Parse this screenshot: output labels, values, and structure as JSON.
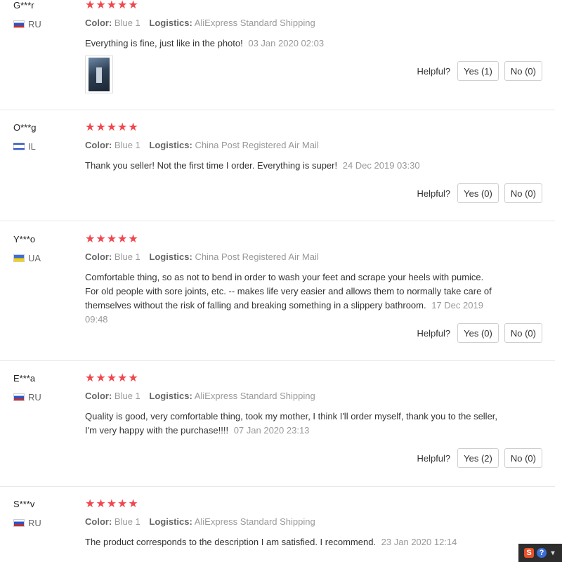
{
  "helpful_label": "Helpful?",
  "color_key": "Color:",
  "logistics_key": "Logistics:",
  "star_glyphs": "★★★★★",
  "reviews": [
    {
      "user": "G***r",
      "country": "RU",
      "color": "Blue 1",
      "logistics": "AliExpress Standard Shipping",
      "text": "Everything is fine, just like in the photo!",
      "date": "03 Jan 2020 02:03",
      "rating": 5,
      "has_photo": true,
      "yes": "Yes (1)",
      "no": "No (0)"
    },
    {
      "user": "O***g",
      "country": "IL",
      "color": "Blue 1",
      "logistics": "China Post Registered Air Mail",
      "text": "Thank you seller! Not the first time I order. Everything is super!",
      "date": "24 Dec 2019 03:30",
      "rating": 5,
      "yes": "Yes (0)",
      "no": "No (0)"
    },
    {
      "user": "Y***o",
      "country": "UA",
      "color": "Blue 1",
      "logistics": "China Post Registered Air Mail",
      "text": "Comfortable thing, so as not to bend in order to wash your feet and scrape your heels with pumice. For old people with sore joints, etc. -- makes life very easier and allows them to normally take care of themselves without the risk of falling and breaking something in a slippery bathroom.",
      "date": "17 Dec 2019 09:48",
      "rating": 5,
      "yes": "Yes (0)",
      "no": "No (0)"
    },
    {
      "user": "E***a",
      "country": "RU",
      "color": "Blue 1",
      "logistics": "AliExpress Standard Shipping",
      "text": "Quality is good, very comfortable thing, took my mother, I think I'll order myself, thank you to the seller, I'm very happy with the purchase!!!!",
      "date": "07 Jan 2020 23:13",
      "rating": 5,
      "yes": "Yes (2)",
      "no": "No (0)"
    },
    {
      "user": "S***v",
      "country": "RU",
      "color": "Blue 1",
      "logistics": "AliExpress Standard Shipping",
      "text": "The product corresponds to the description I am satisfied. I recommend.",
      "date": "23 Jan 2020 12:14",
      "rating": 5
    }
  ],
  "tray": {
    "s_icon": "S",
    "help_icon": "?",
    "chevron_icon": "▾"
  },
  "colors": {
    "star": "#f0474f",
    "meta": "#999999",
    "text": "#333333",
    "tray": "#2d2d2d"
  }
}
